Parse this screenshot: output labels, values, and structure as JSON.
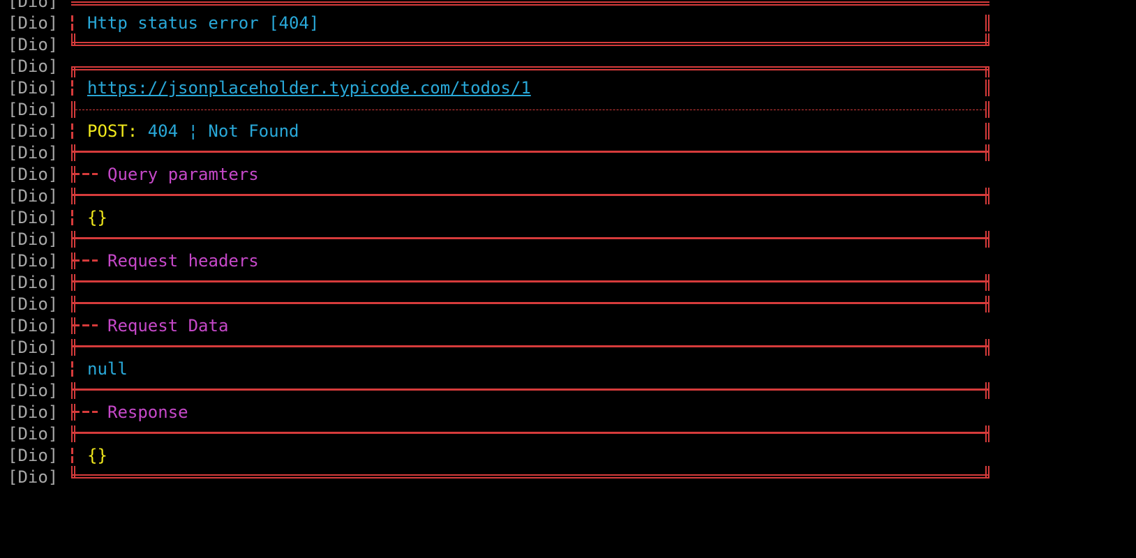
{
  "terminal": {
    "prefix": "[Dio]",
    "partial_prefix": "[Dio]",
    "error_line": "Http status error [404]",
    "url": "https://jsonplaceholder.typicode.com/todos/1",
    "method": "POST:",
    "status_code": "404",
    "status_separator": "¦",
    "status_text": "Not Found",
    "sections": {
      "query_title": "Query paramters",
      "query_body": "{}",
      "headers_title": "Request headers",
      "data_title": "Request Data",
      "data_body": "null",
      "response_title": "Response",
      "response_body": "{}"
    }
  },
  "colors": {
    "background": "#000000",
    "border": "#d63b3b",
    "prefix": "#a8a8a8",
    "blue": "#29a8d8",
    "yellow": "#f0e81c",
    "magenta": "#c548c8"
  }
}
